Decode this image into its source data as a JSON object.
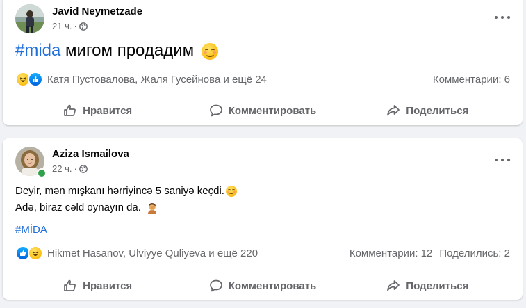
{
  "posts": [
    {
      "author": "Javid Neymetzade",
      "time": "21 ч.",
      "separator": "·",
      "hashtag": "#mida",
      "text": " мигом продадим",
      "emoji": "smiling-face-icon",
      "reactions": [
        "haha-reaction-icon",
        "like-reaction-icon"
      ],
      "reaction_names": "Катя Пустовалова, Жаля Гусейнова и ещё 24",
      "comments": "Комментарии: 6",
      "shares": ""
    },
    {
      "author": "Aziza Ismailova",
      "time": "22 ч.",
      "separator": "·",
      "line1": "Deyir, mən mışkanı hərriyincə 5 saniyə keçdi.",
      "line2": "Adə, biraz cəld oynayın da.",
      "hashtag": "#MİDA",
      "reactions": [
        "like-reaction-icon",
        "haha-reaction-icon"
      ],
      "reaction_names": "Hikmet Hasanov, Ulviyye Quliyeva и ещё 220",
      "comments": "Комментарии: 12",
      "shares": "Поделились: 2",
      "online": true
    }
  ],
  "actions": {
    "like": "Нравится",
    "comment": "Комментировать",
    "share": "Поделиться"
  },
  "colors": {
    "background": "#f0f2f5",
    "card": "#ffffff",
    "hashtag": "#216fdb",
    "secondary_text": "#65676b",
    "online": "#31a24c"
  }
}
